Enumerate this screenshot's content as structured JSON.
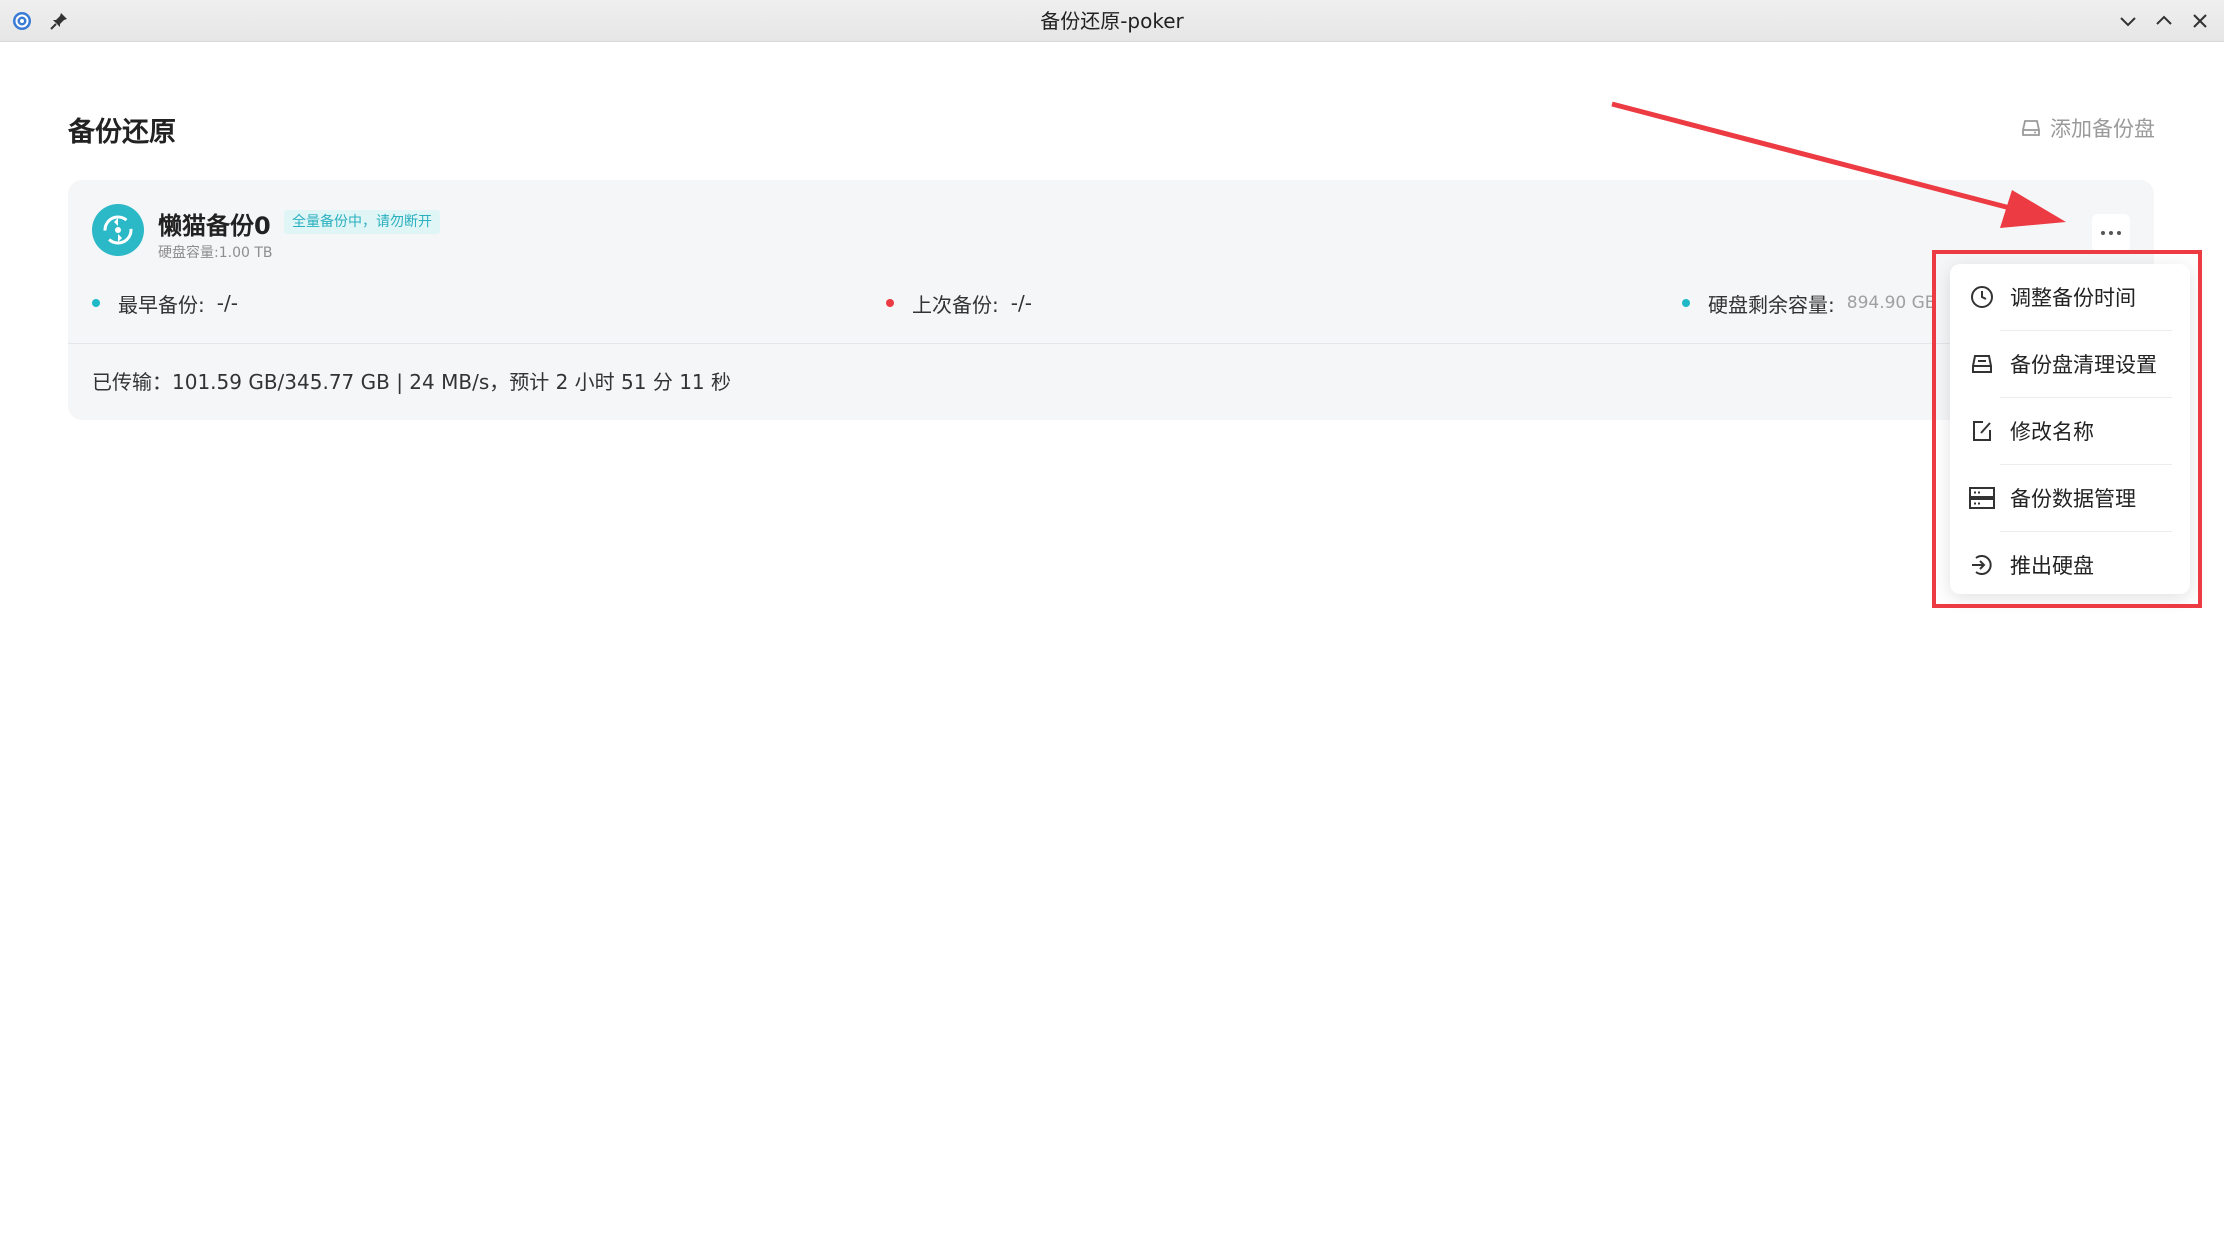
{
  "window": {
    "title": "备份还原-poker"
  },
  "page": {
    "title": "备份还原",
    "add_disk_label": "添加备份盘"
  },
  "backup_card": {
    "name": "懒猫备份0",
    "status_badge": "全量备份中，请勿断开",
    "capacity": "硬盘容量:1.00 TB",
    "stats": [
      {
        "label": "最早备份:",
        "value": "-/-",
        "dot_color": "#1fb8c6"
      },
      {
        "label": "上次备份:",
        "value": "-/-",
        "dot_color": "#ec3b43"
      },
      {
        "label": "硬盘剩余容量:",
        "value": "894.90 GB",
        "dot_color": "#1fb8c6"
      }
    ],
    "progress": "已传输：101.59 GB/345.77 GB | 24 MB/s，预计 2 小时 51 分 11 秒"
  },
  "menu": {
    "items": [
      {
        "label": "调整备份时间",
        "icon": "clock-icon"
      },
      {
        "label": "备份盘清理设置",
        "icon": "disk-icon"
      },
      {
        "label": "修改名称",
        "icon": "edit-icon"
      },
      {
        "label": "备份数据管理",
        "icon": "server-icon"
      },
      {
        "label": "推出硬盘",
        "icon": "eject-icon"
      }
    ]
  },
  "colors": {
    "accent": "#2bb8c7",
    "annotation": "#ec3b43"
  }
}
